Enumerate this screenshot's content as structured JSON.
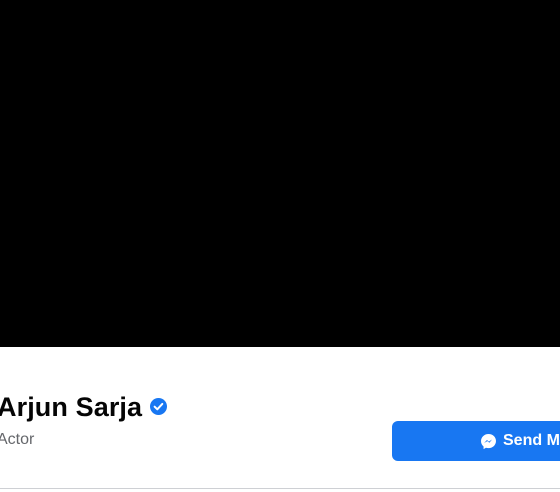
{
  "profile": {
    "name": "Arjun Sarja",
    "category": "Actor",
    "verified_icon": "verified-badge-icon"
  },
  "actions": {
    "send_message_label": "Send M",
    "send_message_icon": "messenger-icon"
  },
  "colors": {
    "cover": "#000000",
    "accent": "#1877f2",
    "name": "#050505",
    "secondary_text": "#65676b",
    "divider": "#ced0d4"
  }
}
